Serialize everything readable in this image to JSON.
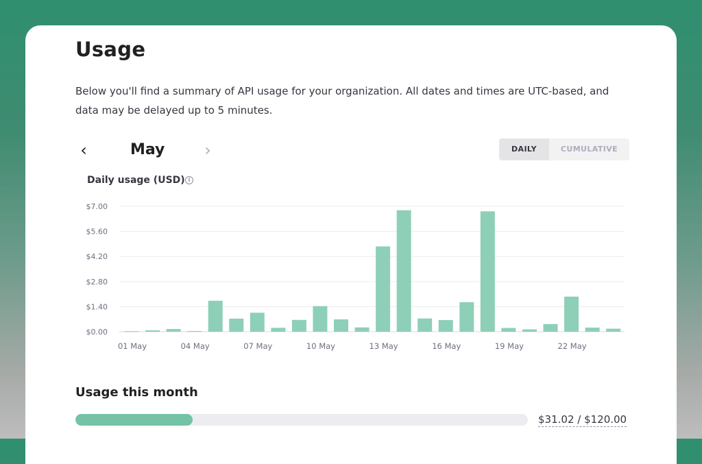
{
  "page": {
    "title": "Usage",
    "intro": "Below you'll find a summary of API usage for your organization. All dates and times are UTC-based, and data may be delayed up to 5 minutes."
  },
  "nav": {
    "month": "May",
    "prev_icon": "chevron-left-icon",
    "next_icon": "chevron-right-icon",
    "view_daily": "DAILY",
    "view_cumulative": "CUMULATIVE",
    "active_view": "DAILY"
  },
  "chart": {
    "title": "Daily usage (USD)",
    "info_icon": "info-icon"
  },
  "chart_data": {
    "type": "bar",
    "title": "Daily usage (USD)",
    "xlabel": "",
    "ylabel": "",
    "ylim": [
      0,
      7
    ],
    "grid": true,
    "y_ticks": [
      "$0.00",
      "$1.40",
      "$2.80",
      "$4.20",
      "$5.60",
      "$7.00"
    ],
    "y_tick_values": [
      0,
      1.4,
      2.8,
      4.2,
      5.6,
      7.0
    ],
    "categories": [
      "01 May",
      "02 May",
      "03 May",
      "04 May",
      "05 May",
      "06 May",
      "07 May",
      "08 May",
      "09 May",
      "10 May",
      "11 May",
      "12 May",
      "13 May",
      "14 May",
      "15 May",
      "16 May",
      "17 May",
      "18 May",
      "19 May",
      "20 May",
      "21 May",
      "22 May",
      "23 May",
      "24 May"
    ],
    "x_tick_labels": [
      "01 May",
      "04 May",
      "07 May",
      "10 May",
      "13 May",
      "16 May",
      "19 May",
      "22 May"
    ],
    "values": [
      0.03,
      0.08,
      0.15,
      0.04,
      1.73,
      0.73,
      1.06,
      0.22,
      0.66,
      1.43,
      0.69,
      0.24,
      4.76,
      6.78,
      0.74,
      0.65,
      1.65,
      6.72,
      0.21,
      0.13,
      0.43,
      1.96,
      0.23,
      0.17
    ],
    "color": "#8ecfb8"
  },
  "usage_month": {
    "title": "Usage this month",
    "used": "$31.02",
    "limit": "$120.00",
    "display": "$31.02 / $120.00",
    "fraction": 0.2585,
    "fill_color": "#74c3a6"
  }
}
